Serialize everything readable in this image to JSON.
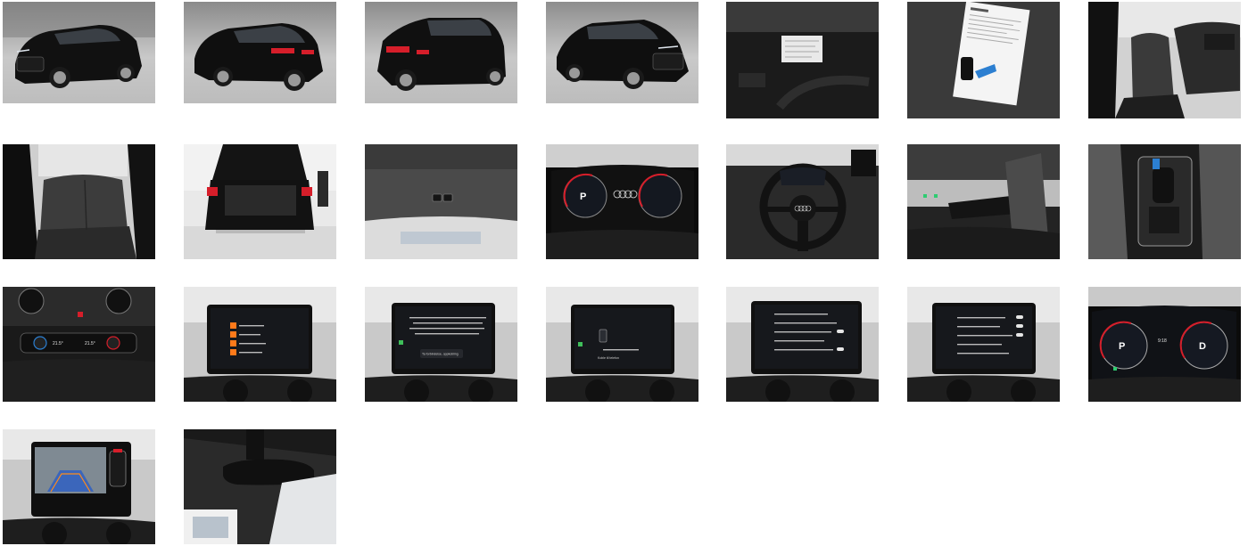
{
  "gallery": {
    "photos": [
      {
        "name": "exterior-front-left-photo"
      },
      {
        "name": "exterior-rear-right-photo"
      },
      {
        "name": "exterior-rear-left-photo"
      },
      {
        "name": "exterior-front-right-photo"
      },
      {
        "name": "engine-bay-label-photo"
      },
      {
        "name": "service-document-keys-photo"
      },
      {
        "name": "front-interior-seats-photo"
      },
      {
        "name": "rear-seats-photo"
      },
      {
        "name": "open-trunk-photo"
      },
      {
        "name": "trunk-lid-switches-photo"
      },
      {
        "name": "instrument-cluster-photo"
      },
      {
        "name": "steering-wheel-photo"
      },
      {
        "name": "wiper-stalk-photo"
      },
      {
        "name": "gear-selector-photo"
      },
      {
        "name": "climate-controls-photo"
      },
      {
        "name": "infotainment-phone-list-photo"
      },
      {
        "name": "infotainment-apple-carplay-photo"
      },
      {
        "name": "infotainment-connect-device-photo"
      },
      {
        "name": "infotainment-settings-list-photo"
      },
      {
        "name": "infotainment-settings-list-2-photo"
      },
      {
        "name": "digital-cockpit-photo"
      },
      {
        "name": "rear-camera-screen-photo"
      },
      {
        "name": "rearview-mirror-photo"
      }
    ]
  },
  "screens": {
    "climate_left": "21.5°",
    "climate_right": "21.5°",
    "cluster_p": "P",
    "cluster_d": "D",
    "cockpit_time": "9:18",
    "connect_button": "Koble til telefon",
    "carplay_button": "Ta forbindelse, oppkobling"
  }
}
